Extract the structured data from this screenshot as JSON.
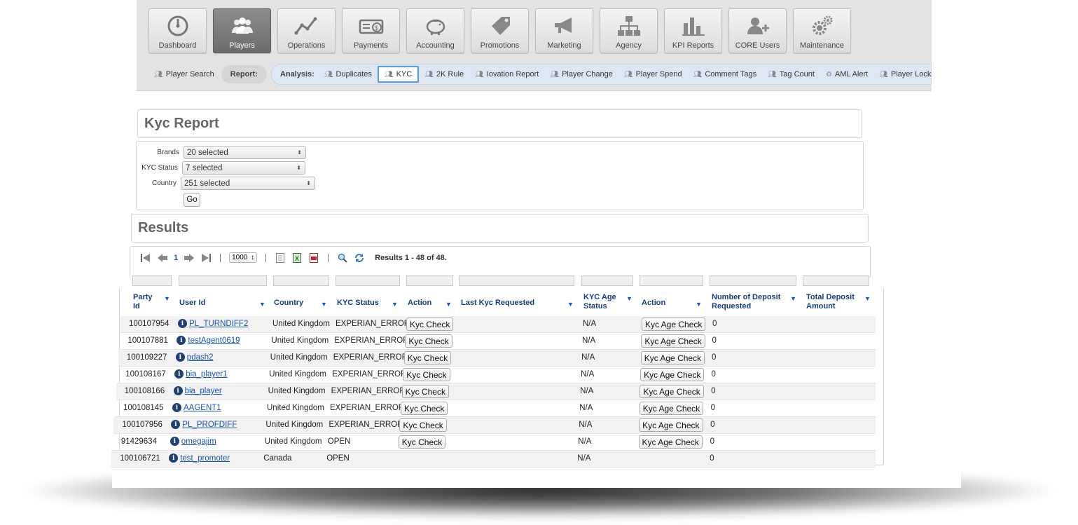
{
  "nav": {
    "tiles": [
      {
        "label": "Dashboard",
        "icon": "gauge-icon"
      },
      {
        "label": "Players",
        "icon": "users-icon",
        "active": true
      },
      {
        "label": "Operations",
        "icon": "line-chart-icon"
      },
      {
        "label": "Payments",
        "icon": "bill-icon"
      },
      {
        "label": "Accounting",
        "icon": "piggy-bank-icon"
      },
      {
        "label": "Promotions",
        "icon": "tag-icon"
      },
      {
        "label": "Marketing",
        "icon": "megaphone-icon"
      },
      {
        "label": "Agency",
        "icon": "org-chart-icon"
      },
      {
        "label": "KPI Reports",
        "icon": "bar-chart-icon"
      },
      {
        "label": "CORE Users",
        "icon": "add-user-icon"
      },
      {
        "label": "Maintenance",
        "icon": "gears-icon"
      }
    ]
  },
  "subnav": {
    "player_search": "Player Search",
    "report_label": "Report:",
    "analysis_label": "Analysis:",
    "items": [
      "Duplicates",
      "KYC",
      "2K Rule",
      "Iovation Report",
      "Player Change",
      "Player Spend",
      "Comment Tags",
      "Tag Count",
      "AML Alert",
      "Player Lock Reason"
    ],
    "selected": "KYC"
  },
  "report": {
    "title": "Kyc Report",
    "filters": {
      "brands_label": "Brands",
      "brands_value": "20 selected",
      "kyc_status_label": "KYC Status",
      "kyc_status_value": "7 selected",
      "country_label": "Country",
      "country_value": "251 selected"
    },
    "go_label": "Go"
  },
  "results": {
    "title": "Results",
    "page": "1",
    "page_size": "1000",
    "summary": "Results 1 - 48 of 48."
  },
  "table": {
    "headers": {
      "party_id": "Party Id",
      "user_id": "User Id",
      "country": "Country",
      "kyc_status": "KYC Status",
      "action1": "Action",
      "last_kyc": "Last Kyc Requested",
      "kyc_age_status": "KYC Age Status",
      "action2": "Action",
      "deposits_requested": "Number of Deposit Requested",
      "total_deposit": "Total Deposit Amount"
    },
    "kyc_check_label": "Kyc Check",
    "kyc_age_check_label": "Kyc Age Check",
    "rows": [
      {
        "party_id": "100107954",
        "user_id": "PL_TURNDIFF2",
        "country": "United Kingdom",
        "kyc_status": "EXPERIAN_ERROR",
        "kyc_age_status": "N/A",
        "deposits": "0",
        "has_kyc_btn": true,
        "has_age_btn": true
      },
      {
        "party_id": "100107881",
        "user_id": "testAgent0619",
        "country": "United Kingdom",
        "kyc_status": "EXPERIAN_ERROR",
        "kyc_age_status": "N/A",
        "deposits": "0",
        "has_kyc_btn": true,
        "has_age_btn": true
      },
      {
        "party_id": "100109227",
        "user_id": "pdash2",
        "country": "United Kingdom",
        "kyc_status": "EXPERIAN_ERROR",
        "kyc_age_status": "N/A",
        "deposits": "0",
        "has_kyc_btn": true,
        "has_age_btn": true
      },
      {
        "party_id": "100108167",
        "user_id": "bia_player1",
        "country": "United Kingdom",
        "kyc_status": "EXPERIAN_ERROR",
        "kyc_age_status": "N/A",
        "deposits": "0",
        "has_kyc_btn": true,
        "has_age_btn": true
      },
      {
        "party_id": "100108166",
        "user_id": "bia_player",
        "country": "United Kingdom",
        "kyc_status": "EXPERIAN_ERROR",
        "kyc_age_status": "N/A",
        "deposits": "0",
        "has_kyc_btn": true,
        "has_age_btn": true
      },
      {
        "party_id": "100108145",
        "user_id": "AAGENT1",
        "country": "United Kingdom",
        "kyc_status": "EXPERIAN_ERROR",
        "kyc_age_status": "N/A",
        "deposits": "0",
        "has_kyc_btn": true,
        "has_age_btn": true
      },
      {
        "party_id": "100107956",
        "user_id": "PL_PROFDIFF",
        "country": "United Kingdom",
        "kyc_status": "EXPERIAN_ERROR",
        "kyc_age_status": "N/A",
        "deposits": "0",
        "has_kyc_btn": true,
        "has_age_btn": true
      },
      {
        "party_id": "91429634",
        "user_id": "omegajim",
        "country": "United Kingdom",
        "kyc_status": "OPEN",
        "kyc_age_status": "N/A",
        "deposits": "0",
        "has_kyc_btn": true,
        "has_age_btn": true
      },
      {
        "party_id": "100106721",
        "user_id": "test_promoter",
        "country": "Canada",
        "kyc_status": "OPEN",
        "kyc_age_status": "N/A",
        "deposits": "0",
        "has_kyc_btn": false,
        "has_age_btn": false
      }
    ]
  }
}
